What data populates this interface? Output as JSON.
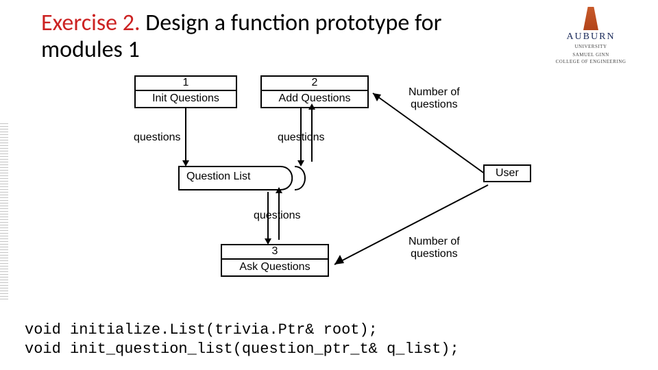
{
  "title": {
    "prefix": "Exercise 2.",
    "rest": " Design a function prototype for modules 1"
  },
  "logo": {
    "name": "AUBURN",
    "sub1": "UNIVERSITY",
    "sub2": "SAMUEL GINN",
    "sub3": "COLLEGE OF ENGINEERING"
  },
  "boxes": {
    "b1": {
      "num": "1",
      "label": "Init Questions"
    },
    "b2": {
      "num": "2",
      "label": "Add Questions"
    },
    "b3": {
      "num": "3",
      "label": "Ask Questions"
    }
  },
  "labels": {
    "q_out_1": "questions",
    "q_out_2": "questions",
    "q_down_3": "questions",
    "numq_1": "Number of\nquestions",
    "numq_2": "Number of\nquestions",
    "qlist": "Question List",
    "user": "User"
  },
  "code": {
    "line1": "void initialize.List(trivia.Ptr& root);",
    "line2": "void init_question_list(question_ptr_t& q_list);"
  }
}
